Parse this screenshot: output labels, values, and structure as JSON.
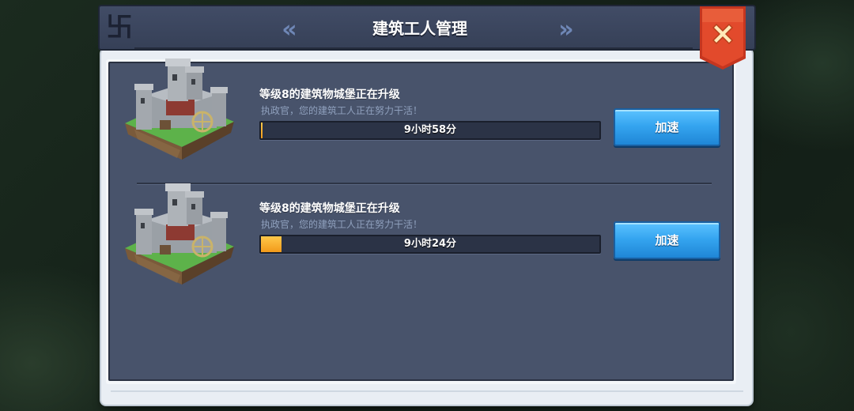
{
  "header": {
    "title": "建筑工人管理"
  },
  "colors": {
    "panel_bg": "#48536b",
    "accent_blue": "#35a5f0",
    "progress_orange": "#f29a1a",
    "close_red": "#d8432a"
  },
  "icons": {
    "close": "close-x-icon",
    "prev": "double-chevron-left-icon",
    "next": "double-chevron-right-icon",
    "building": "castle-icon"
  },
  "builders": [
    {
      "name": "等级8的建筑物城堡正在升级",
      "subtitle": "执政官，您的建筑工人正在努力干活！",
      "time_remaining": "9小时58分",
      "progress_percent": 0.5,
      "button_label": "加速"
    },
    {
      "name": "等级8的建筑物城堡正在升级",
      "subtitle": "执政官，您的建筑工人正在努力干活！",
      "time_remaining": "9小时24分",
      "progress_percent": 6,
      "button_label": "加速"
    }
  ]
}
